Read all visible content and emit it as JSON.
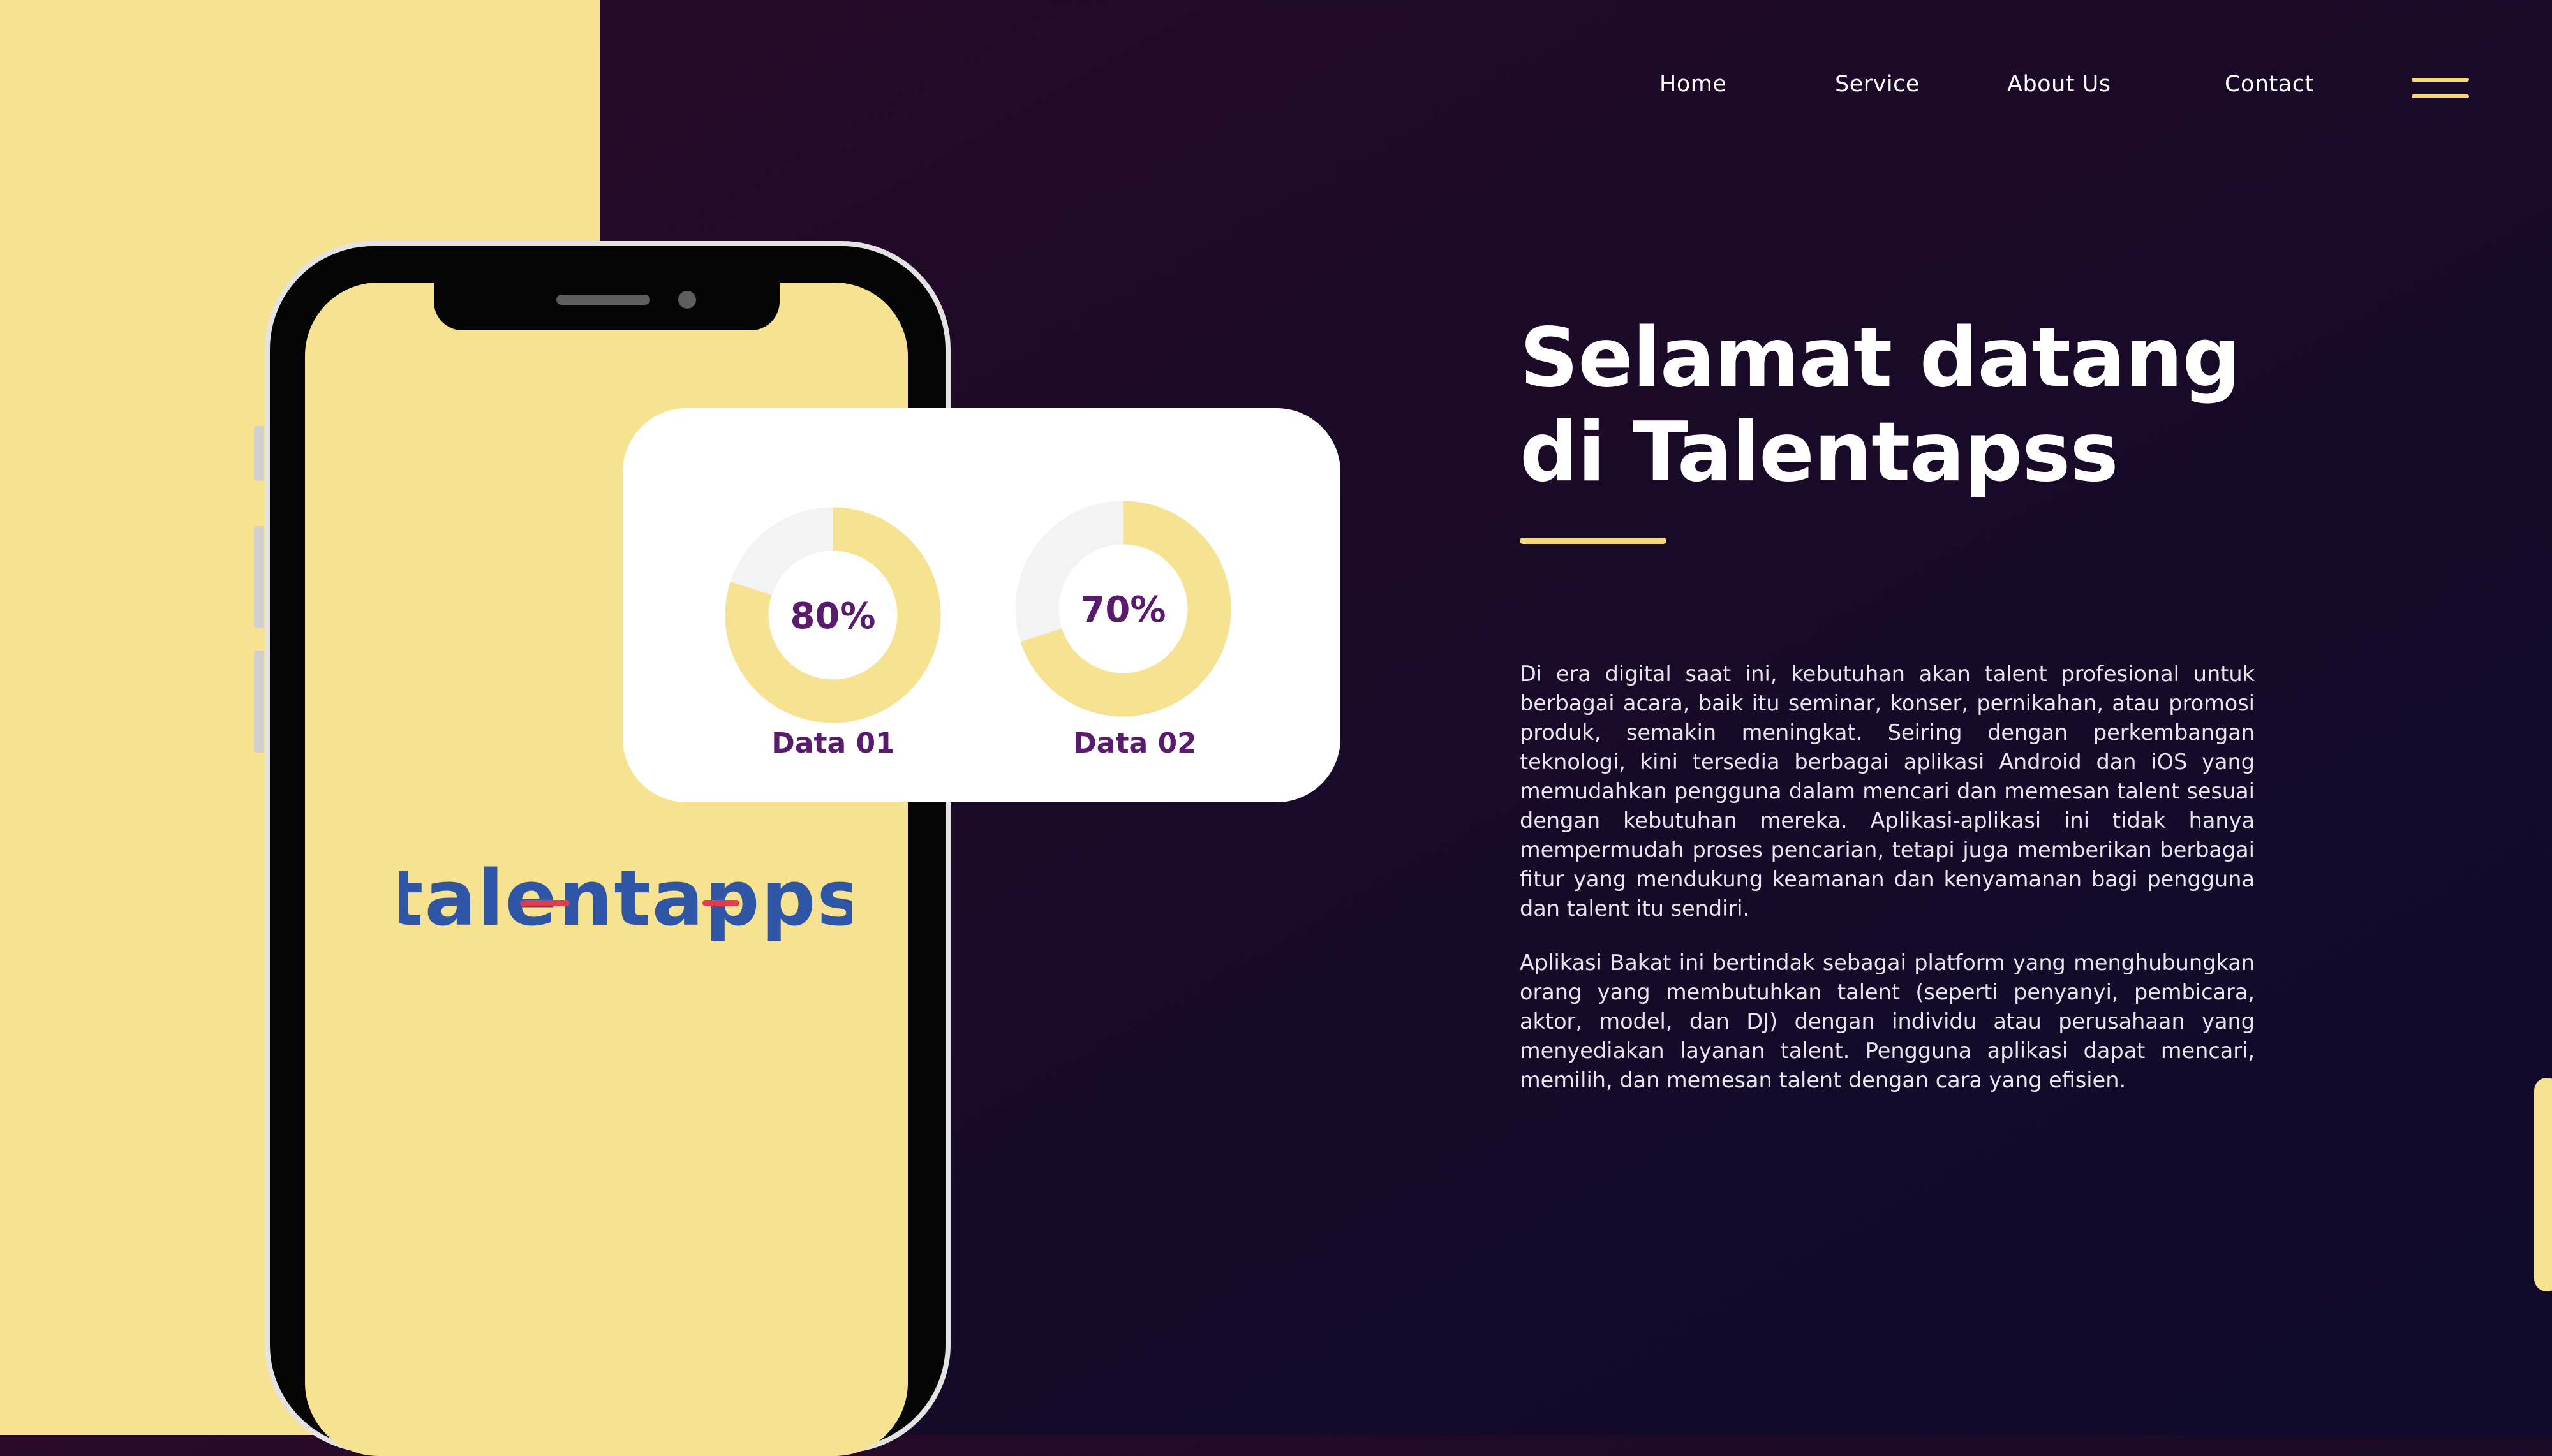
{
  "nav": {
    "items": [
      {
        "label": "Home"
      },
      {
        "label": "Service"
      },
      {
        "label": "About Us"
      },
      {
        "label": "Contact"
      }
    ],
    "menu_icon": "hamburger-menu-icon"
  },
  "phone": {
    "app_logo_text": "talentapps"
  },
  "stats_card": {
    "items": [
      {
        "label": "Data 01",
        "percent": 80,
        "display": "80%"
      },
      {
        "label": "Data 02",
        "percent": 70,
        "display": "70%"
      }
    ]
  },
  "hero": {
    "title_line1": "Selamat datang",
    "title_line2": "di Talentapss",
    "paragraph1": "Di era digital saat ini, kebutuhan akan talent profesional untuk berbagai acara, baik itu seminar, konser, pernikahan, atau promosi produk, semakin meningkat. Seiring dengan perkembangan teknologi, kini tersedia berbagai aplikasi Android dan iOS yang memudahkan pengguna dalam mencari dan memesan talent sesuai dengan kebutuhan mereka. Aplikasi-aplikasi ini tidak hanya mempermudah proses pencarian, tetapi juga memberikan berbagai fitur yang mendukung keamanan dan kenyamanan bagi pengguna dan talent itu sendiri.",
    "paragraph2": "Aplikasi Bakat ini bertindak sebagai platform yang menghubungkan orang yang membutuhkan talent (seperti penyanyi, pembicara, aktor, model, dan DJ) dengan individu atau perusahaan yang menyediakan layanan talent. Pengguna aplikasi dapat mencari, memilih, dan memesan talent dengan cara yang efisien."
  },
  "colors": {
    "accent_yellow": "#f6e290",
    "underline_yellow": "#f6d77a",
    "donut_track": "#f3f3f3",
    "purple_text": "#5a1a6e",
    "background_dark": "#1a0a28",
    "logo_blue": "#2f56a6",
    "logo_red": "#e23b4c"
  }
}
